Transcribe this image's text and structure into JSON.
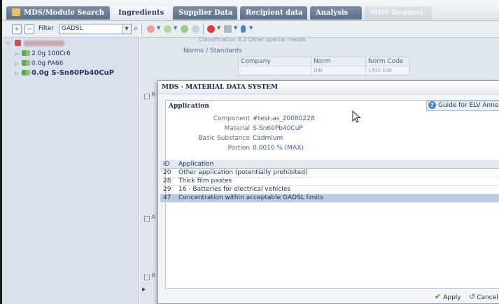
{
  "tabs": [
    {
      "label": "MDS/Module Search",
      "state": "inactive"
    },
    {
      "label": "Ingredients",
      "state": "active"
    },
    {
      "label": "Supplier Data",
      "state": "inactive"
    },
    {
      "label": "Recipient data",
      "state": "inactive"
    },
    {
      "label": "Analysis",
      "state": "inactive"
    },
    {
      "label": "MDS Request",
      "state": "disabled"
    }
  ],
  "left_panel": {
    "filter_label": "Filter",
    "filter_value": "GADSL",
    "tree": [
      {
        "label": "2.0g 100Cr6",
        "bold": false
      },
      {
        "label": "0.0g PA66",
        "bold": false
      },
      {
        "label": "0.0g S-Sn60Pb40CuP",
        "bold": true
      }
    ]
  },
  "main": {
    "classification_text": "Classification   4.2 Other special metals",
    "norms_title": "Norms / Standards",
    "norms_table": {
      "headers": [
        "Company",
        "Norm",
        "Norm Code"
      ],
      "rows": [
        [
          "-",
          "DIN",
          "1707-100"
        ]
      ]
    },
    "collapse_labels": [
      "R",
      "A",
      "R"
    ]
  },
  "dialog": {
    "title": "MDS - MATERIAL DATA SYSTEM",
    "section_title": "Application",
    "guide_button": "Guide for ELV Annex II",
    "fields": [
      {
        "label": "Component",
        "value": "#test-as_20080228"
      },
      {
        "label": "Material",
        "value": "S-Sn60Pb40CuP"
      },
      {
        "label": "Basic Substance",
        "value": "Cadmium"
      },
      {
        "label": "Portion",
        "value": "0.0010 % (MAX)"
      }
    ],
    "table": {
      "headers": [
        "ID",
        "Application"
      ],
      "rows": [
        {
          "id": "20",
          "application": "Other application (potentially prohibited)"
        },
        {
          "id": "28",
          "application": "Thick film pastes"
        },
        {
          "id": "29",
          "application": "16 - Batteries for electrical vehicles"
        },
        {
          "id": "47",
          "application": "Concentration within acceptable GADSL limits"
        }
      ],
      "selected_id": "47"
    },
    "apply_label": "Apply",
    "cancel_label": "Cancel"
  },
  "colors": {
    "accent": "#5b6f89",
    "selection": "#bccbdd",
    "apply_check": "#3b9a2f"
  }
}
